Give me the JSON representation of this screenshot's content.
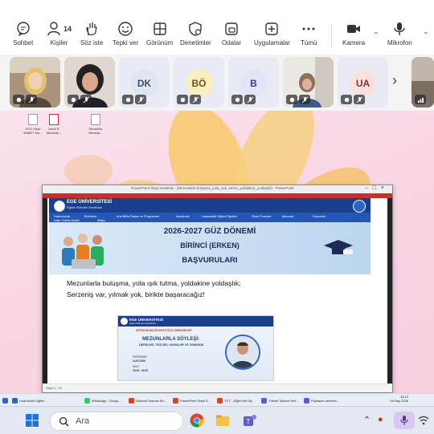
{
  "toolbar": {
    "items": [
      {
        "label": "Sohbet",
        "icon": "chat-icon"
      },
      {
        "label": "Kişiler",
        "icon": "people-icon",
        "count": "14"
      },
      {
        "label": "Söz iste",
        "icon": "raise-hand-icon"
      },
      {
        "label": "Tepki ver",
        "icon": "emoji-icon"
      },
      {
        "label": "Görünüm",
        "icon": "layout-icon"
      },
      {
        "label": "Denetimler",
        "icon": "controls-icon"
      },
      {
        "label": "Odalar",
        "icon": "rooms-icon"
      },
      {
        "label": "Uygulamalar",
        "icon": "apps-plus-icon"
      },
      {
        "label": "Tümü",
        "icon": "more-icon"
      },
      {
        "label": "Kamera",
        "icon": "camera-icon"
      },
      {
        "label": "Mikrofon",
        "icon": "microphone-icon"
      }
    ]
  },
  "participants": [
    {
      "initials": "",
      "type": "video-woman-blonde"
    },
    {
      "initials": "",
      "type": "video-woman-dark"
    },
    {
      "initials": "DK",
      "color": "#dfe6f0",
      "fg": "#3d4f6a"
    },
    {
      "initials": "BÖ",
      "color": "#fbeec0",
      "fg": "#6a5418"
    },
    {
      "initials": "B",
      "color": "#e2e4f8",
      "fg": "#3a3f7a"
    },
    {
      "initials": "",
      "type": "video-woman-headscarf"
    },
    {
      "initials": "UA",
      "color": "#fbe0e0",
      "fg": "#8a2f2f"
    },
    {
      "initials": "",
      "type": "video-partial"
    }
  ],
  "desktop_icons": [
    {
      "label": "SGU Kayıt BABET Mu..."
    },
    {
      "label": "kazık B Mrsölülü..."
    },
    {
      "label": "Ekranlılık bilmede..."
    }
  ],
  "ppt": {
    "window_title": "PowerPoint Slayt Gösterisi - [Mezunlarla buluşma_yola_ışık_tutma_yoldakine_yoldaşlık] - PowerPoint",
    "status": "Slayt 1 / 19"
  },
  "site": {
    "name": "EGE ÜNİVERSİTESİ",
    "subtitle": "Eğitim Bilimleri Enstitüsü",
    "nav": [
      "Hakkımızda",
      "Birimimiz",
      "Ana Bilim Dalları ve Programlar",
      "Akademik",
      "Lisansüstü Eğitim Öğretim",
      "Öneri Formları",
      "Mevzuat",
      "Duyurular",
      "Kalite Yönetim Sistemi",
      "İletişim"
    ],
    "banner_line1": "2026-2027 GÜZ DÖNEMİ",
    "banner_line2": "BİRİNCİ (ERKEN)",
    "banner_line3": "BAŞVURULARI"
  },
  "slide_text": {
    "line1": "Mezunlarla buluşma, yola ışık tutma, yoldakine yoldaşlık;",
    "line2": "Serzeniş var, yılmak yok, birikte başaracağız!"
  },
  "announcement": {
    "name": "EGE ÜNİVERSİTESİ",
    "subtitle": "Eğitim Bilimleri Enstitüsü",
    "ribbon": "EĞİTİM BİLİMLERİ ENSTİTÜSÜ SEMİNERLERİ",
    "title": "MEZUNLARLA SÖYLEŞİ:",
    "title2": "DERSLER, TEZLER, YAYINLAR VE SONRASI",
    "date_label": "PERŞEMBE",
    "date": "14.05.2026",
    "time_label": "SAAT",
    "time": "15:00 - 16:00"
  },
  "running_apps": [
    {
      "label": "Lisansüstü Eğitim...",
      "color": "#2b66c7"
    },
    {
      "label": "WhatsApp - Googl...",
      "color": "#25d366"
    },
    {
      "label": "Doktora Sonrası Bil...",
      "color": "#d24726"
    },
    {
      "label": "PowerPoint Slayt S...",
      "color": "#d24726"
    },
    {
      "label": "TCT - (Eğim Ant Üy...",
      "color": "#d24726"
    },
    {
      "label": "Yüksel Toplant Sen...",
      "color": "#5b5fc7"
    },
    {
      "label": "Paylaşım denetim...",
      "color": "#5b5fc7"
    }
  ],
  "tray": {
    "time": "15:13",
    "date": "14 May 2026"
  },
  "taskbar": {
    "search_placeholder": "Ara"
  }
}
